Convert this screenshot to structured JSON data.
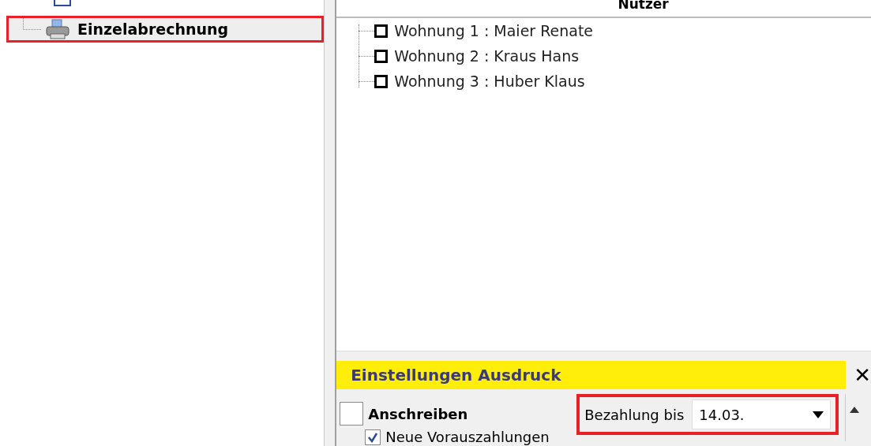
{
  "sidebar": {
    "items": [
      {
        "label": "Einzelabrechnung",
        "selected": true,
        "highlighted": true
      }
    ]
  },
  "users": {
    "header": "Nutzer",
    "items": [
      {
        "label": "Wohnung 1 : Maier Renate",
        "checked": false
      },
      {
        "label": "Wohnung 2 : Kraus Hans",
        "checked": false
      },
      {
        "label": "Wohnung 3 : Huber Klaus",
        "checked": false
      }
    ]
  },
  "print_settings": {
    "title": "Einstellungen Ausdruck",
    "close": "✕",
    "options": [
      {
        "label": "Anschreiben",
        "checked": false,
        "bold": true
      },
      {
        "label": "Neue Vorauszahlungen",
        "checked": true,
        "bold": false
      }
    ],
    "payment": {
      "label": "Bezahlung bis",
      "value": "14.03.",
      "highlighted": true
    }
  }
}
